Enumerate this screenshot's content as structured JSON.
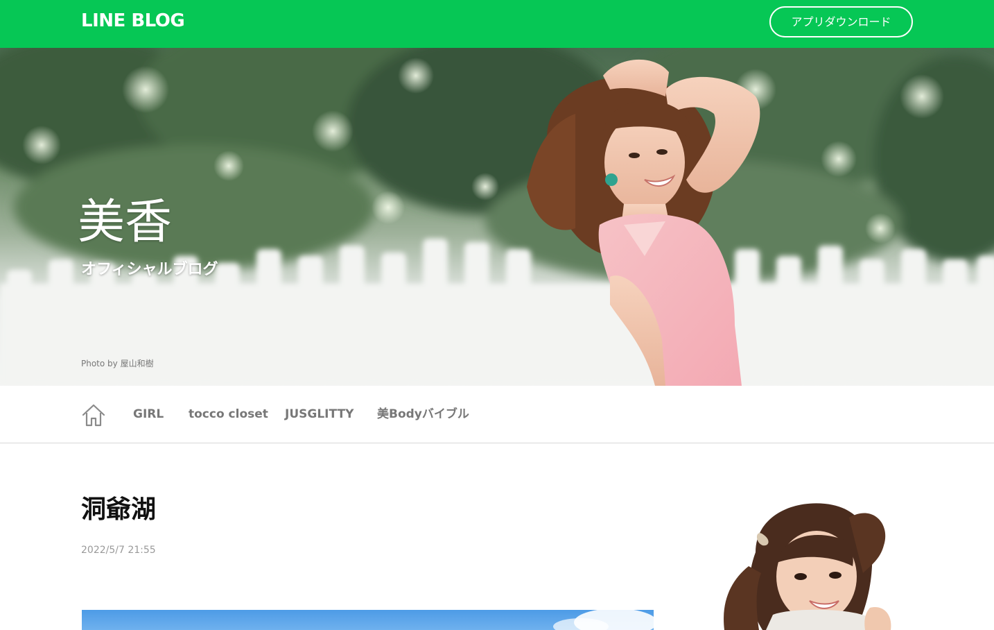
{
  "header": {
    "logo_text": "LINE BLOG",
    "app_download_label": "アプリダウンロード",
    "brand_color": "#06c755"
  },
  "hero": {
    "title": "美香",
    "subtitle": "オフィシャルブログ",
    "photo_credit": "Photo by 屋山和樹"
  },
  "nav": {
    "home_icon": "home-icon",
    "items": [
      {
        "label": "GIRL"
      },
      {
        "label": "tocco closet"
      },
      {
        "label": "JUSGLITTY"
      },
      {
        "label": "美Bodyバイブル"
      }
    ]
  },
  "article": {
    "title": "洞爺湖",
    "date": "2022/5/7 21:55"
  }
}
